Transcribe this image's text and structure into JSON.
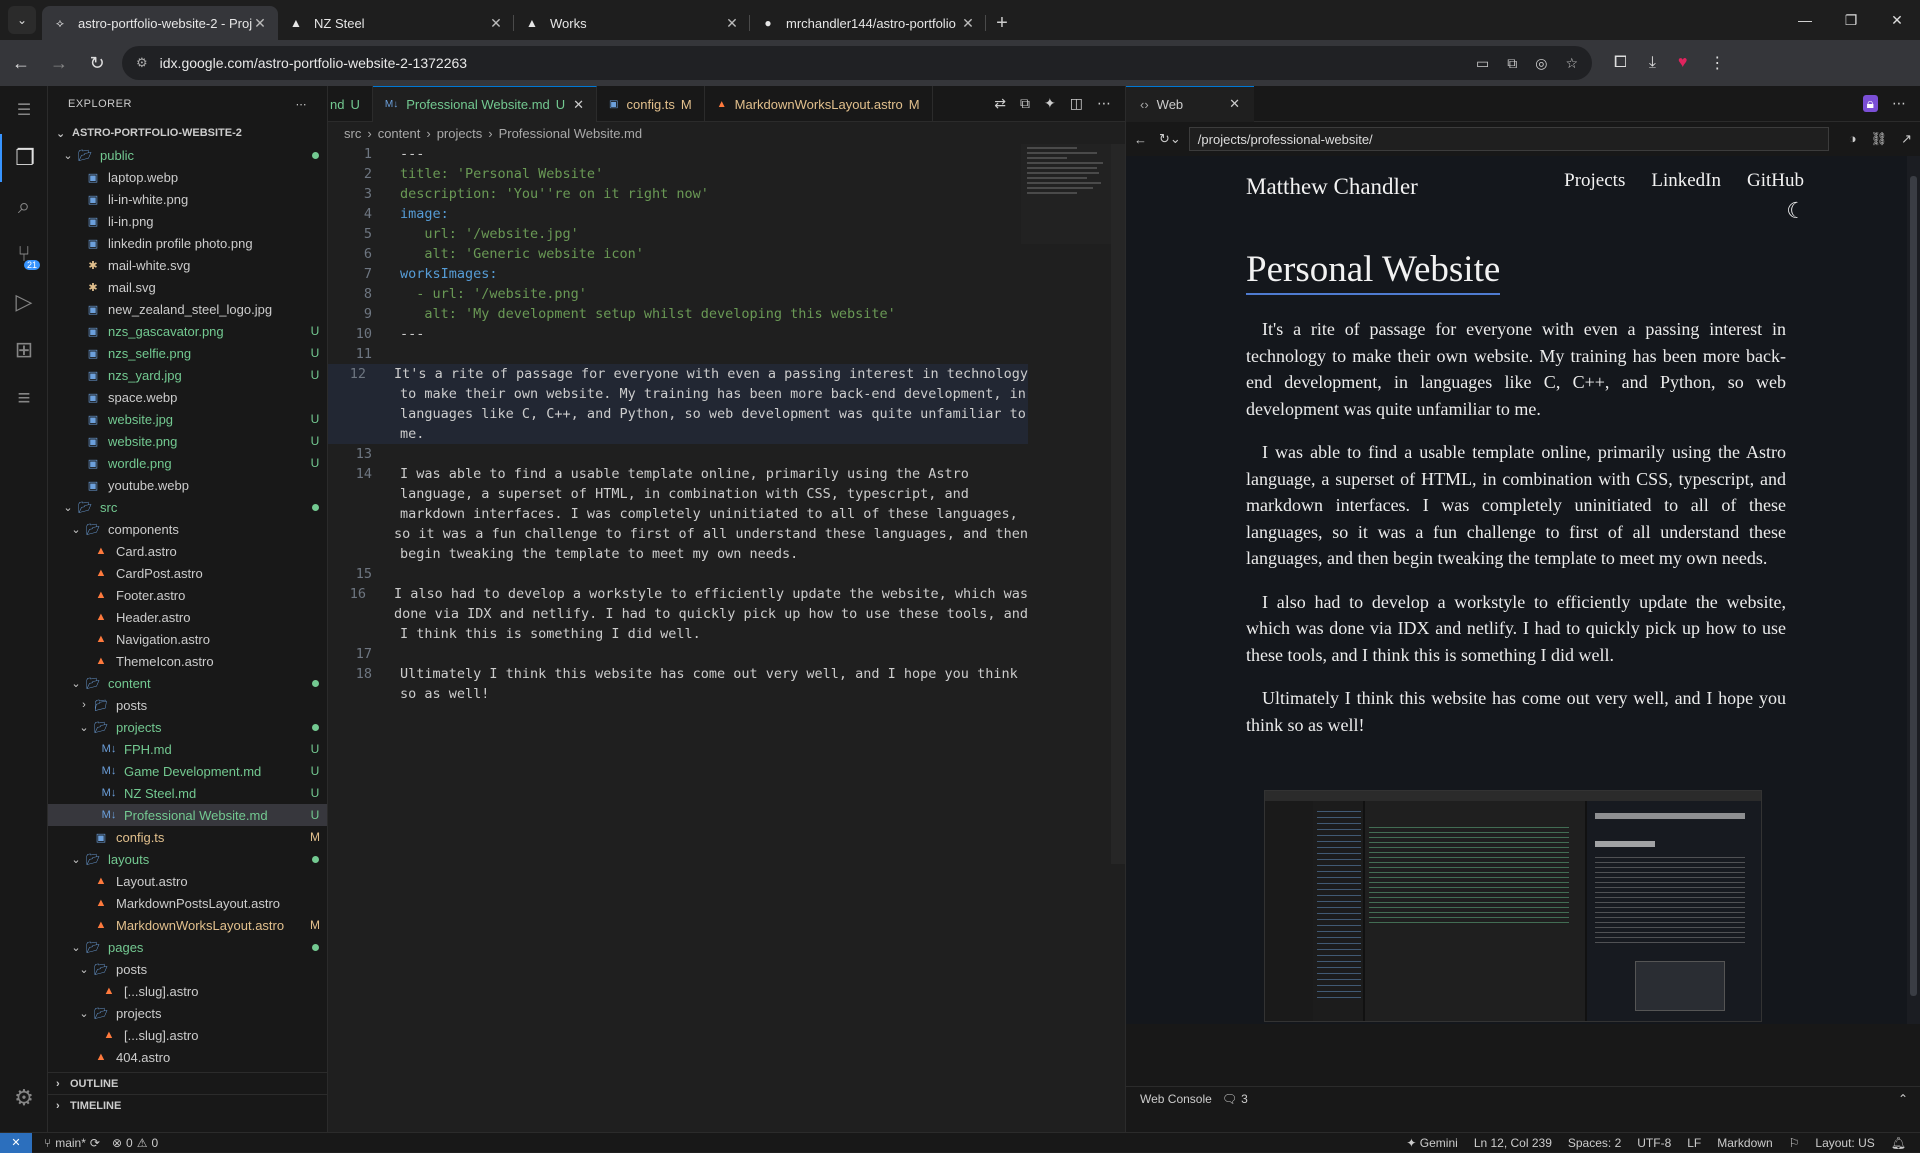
{
  "browser": {
    "tabs": [
      {
        "title": "astro-portfolio-website-2 - Proj",
        "icon": "idx-icon",
        "active": true
      },
      {
        "title": "NZ Steel",
        "icon": "astro-icon",
        "active": false
      },
      {
        "title": "Works",
        "icon": "astro-icon",
        "active": false
      },
      {
        "title": "mrchandler144/astro-portfolio",
        "icon": "github-icon",
        "active": false
      }
    ],
    "url": "idx.google.com/astro-portfolio-website-2-1372263"
  },
  "sidebar": {
    "header": "EXPLORER",
    "root": "ASTRO-PORTFOLIO-WEBSITE-2",
    "items": [
      {
        "label": "public",
        "indent": 1,
        "kind": "folder-open",
        "status": "dot"
      },
      {
        "label": "laptop.webp",
        "indent": 2,
        "kind": "image",
        "status": ""
      },
      {
        "label": "li-in-white.png",
        "indent": 2,
        "kind": "image",
        "status": ""
      },
      {
        "label": "li-in.png",
        "indent": 2,
        "kind": "image",
        "status": ""
      },
      {
        "label": "linkedin profile photo.png",
        "indent": 2,
        "kind": "image",
        "status": ""
      },
      {
        "label": "mail-white.svg",
        "indent": 2,
        "kind": "svg",
        "status": ""
      },
      {
        "label": "mail.svg",
        "indent": 2,
        "kind": "svg",
        "status": ""
      },
      {
        "label": "new_zealand_steel_logo.jpg",
        "indent": 2,
        "kind": "image",
        "status": ""
      },
      {
        "label": "nzs_gascavator.png",
        "indent": 2,
        "kind": "image",
        "status": "U"
      },
      {
        "label": "nzs_selfie.png",
        "indent": 2,
        "kind": "image",
        "status": "U"
      },
      {
        "label": "nzs_yard.jpg",
        "indent": 2,
        "kind": "image",
        "status": "U"
      },
      {
        "label": "space.webp",
        "indent": 2,
        "kind": "image",
        "status": ""
      },
      {
        "label": "website.jpg",
        "indent": 2,
        "kind": "image",
        "status": "U"
      },
      {
        "label": "website.png",
        "indent": 2,
        "kind": "image",
        "status": "U"
      },
      {
        "label": "wordle.png",
        "indent": 2,
        "kind": "image",
        "status": "U"
      },
      {
        "label": "youtube.webp",
        "indent": 2,
        "kind": "image",
        "status": ""
      },
      {
        "label": "src",
        "indent": 1,
        "kind": "folder-open",
        "status": "dot"
      },
      {
        "label": "components",
        "indent": 2,
        "kind": "folder-open",
        "status": ""
      },
      {
        "label": "Card.astro",
        "indent": 3,
        "kind": "astro",
        "status": ""
      },
      {
        "label": "CardPost.astro",
        "indent": 3,
        "kind": "astro",
        "status": ""
      },
      {
        "label": "Footer.astro",
        "indent": 3,
        "kind": "astro",
        "status": ""
      },
      {
        "label": "Header.astro",
        "indent": 3,
        "kind": "astro",
        "status": ""
      },
      {
        "label": "Navigation.astro",
        "indent": 3,
        "kind": "astro",
        "status": ""
      },
      {
        "label": "ThemeIcon.astro",
        "indent": 3,
        "kind": "astro",
        "status": ""
      },
      {
        "label": "content",
        "indent": 2,
        "kind": "folder-open",
        "status": "dot"
      },
      {
        "label": "posts",
        "indent": 3,
        "kind": "folder-closed",
        "status": ""
      },
      {
        "label": "projects",
        "indent": 3,
        "kind": "folder-open",
        "status": "dot"
      },
      {
        "label": "FPH.md",
        "indent": 4,
        "kind": "md",
        "status": "U"
      },
      {
        "label": "Game Development.md",
        "indent": 4,
        "kind": "md",
        "status": "U"
      },
      {
        "label": "NZ Steel.md",
        "indent": 4,
        "kind": "md",
        "status": "U"
      },
      {
        "label": "Professional Website.md",
        "indent": 4,
        "kind": "md",
        "status": "U",
        "selected": true
      },
      {
        "label": "config.ts",
        "indent": 3,
        "kind": "ts",
        "status": "M"
      },
      {
        "label": "layouts",
        "indent": 2,
        "kind": "folder-open",
        "status": "dot"
      },
      {
        "label": "Layout.astro",
        "indent": 3,
        "kind": "astro",
        "status": ""
      },
      {
        "label": "MarkdownPostsLayout.astro",
        "indent": 3,
        "kind": "astro",
        "status": ""
      },
      {
        "label": "MarkdownWorksLayout.astro",
        "indent": 3,
        "kind": "astro",
        "status": "M"
      },
      {
        "label": "pages",
        "indent": 2,
        "kind": "folder-open",
        "status": "dot"
      },
      {
        "label": "posts",
        "indent": 3,
        "kind": "folder-open",
        "status": ""
      },
      {
        "label": "[...slug].astro",
        "indent": 4,
        "kind": "astro",
        "status": ""
      },
      {
        "label": "projects",
        "indent": 3,
        "kind": "folder-open",
        "status": ""
      },
      {
        "label": "[...slug].astro",
        "indent": 4,
        "kind": "astro",
        "status": ""
      },
      {
        "label": "404.astro",
        "indent": 3,
        "kind": "astro",
        "status": ""
      }
    ],
    "outline": "OUTLINE",
    "timeline": "TIMELINE"
  },
  "editor": {
    "tabs": [
      {
        "label": "nd",
        "status": "U",
        "icon": "md"
      },
      {
        "label": "Professional Website.md",
        "status": "U",
        "icon": "md",
        "active": true
      },
      {
        "label": "config.ts",
        "status": "M",
        "icon": "ts"
      },
      {
        "label": "MarkdownWorksLayout.astro",
        "status": "M",
        "icon": "astro"
      }
    ],
    "breadcrumb": [
      "src",
      "content",
      "projects",
      "Professional Website.md"
    ],
    "lines": [
      {
        "n": "1",
        "t": "---"
      },
      {
        "n": "2",
        "t": "title: 'Personal Website'"
      },
      {
        "n": "3",
        "t": "description: 'You''re on it right now'"
      },
      {
        "n": "4",
        "t": "image:"
      },
      {
        "n": "5",
        "t": "   url: '/website.jpg'"
      },
      {
        "n": "6",
        "t": "   alt: 'Generic website icon'"
      },
      {
        "n": "7",
        "t": "worksImages:"
      },
      {
        "n": "8",
        "t": "  - url: '/website.png'"
      },
      {
        "n": "9",
        "t": "   alt: 'My development setup whilst developing this website'"
      },
      {
        "n": "10",
        "t": "---"
      },
      {
        "n": "11",
        "t": ""
      },
      {
        "n": "12",
        "t": "It's a rite of passage for everyone with even a passing interest in technology"
      },
      {
        "n": "",
        "t": "to make their own website. My training has been more back-end development, in"
      },
      {
        "n": "",
        "t": "languages like C, C++, and Python, so web development was quite unfamiliar to"
      },
      {
        "n": "",
        "t": "me."
      },
      {
        "n": "13",
        "t": ""
      },
      {
        "n": "14",
        "t": "I was able to find a usable template online, primarily using the Astro"
      },
      {
        "n": "",
        "t": "language, a superset of HTML, in combination with CSS, typescript, and"
      },
      {
        "n": "",
        "t": "markdown interfaces. I was completely uninitiated to all of these languages,"
      },
      {
        "n": "",
        "t": "so it was a fun challenge to first of all understand these languages, and then"
      },
      {
        "n": "",
        "t": "begin tweaking the template to meet my own needs."
      },
      {
        "n": "15",
        "t": ""
      },
      {
        "n": "16",
        "t": "I also had to develop a workstyle to efficiently update the website, which was"
      },
      {
        "n": "",
        "t": "done via IDX and netlify. I had to quickly pick up how to use these tools, and"
      },
      {
        "n": "",
        "t": "I think this is something I did well."
      },
      {
        "n": "17",
        "t": ""
      },
      {
        "n": "18",
        "t": "Ultimately I think this website has come out very well, and I hope you think"
      },
      {
        "n": "",
        "t": "so as well!"
      }
    ]
  },
  "preview": {
    "tab": "Web",
    "url": "/projects/professional-website/",
    "site": {
      "name": "Matthew Chandler",
      "nav": [
        "Projects",
        "LinkedIn",
        "GitHub"
      ],
      "title": "Personal Website",
      "paragraphs": [
        "It's a rite of passage for everyone with even a passing interest in technology to make their own website. My training has been more back-end development, in languages like C, C++, and Python, so web development was quite unfamiliar to me.",
        "I was able to find a usable template online, primarily using the Astro language, a superset of HTML, in combination with CSS, typescript, and markdown interfaces. I was completely uninitiated to all of these languages, so it was a fun challenge to first of all understand these languages, and then begin tweaking the template to meet my own needs.",
        "I also had to develop a workstyle to efficiently update the website, which was done via IDX and netlify. I had to quickly pick up how to use these tools, and I think this is something I did well.",
        "Ultimately I think this website has come out very well, and I hope you think so as well!"
      ]
    },
    "console_label": "Web Console",
    "console_count": "3"
  },
  "status": {
    "branch": "main*",
    "errors": "0",
    "warnings": "0",
    "gemini": "Gemini",
    "position": "Ln 12, Col 239",
    "spaces": "Spaces: 2",
    "encoding": "UTF-8",
    "eol": "LF",
    "language": "Markdown",
    "layout": "Layout: US"
  }
}
